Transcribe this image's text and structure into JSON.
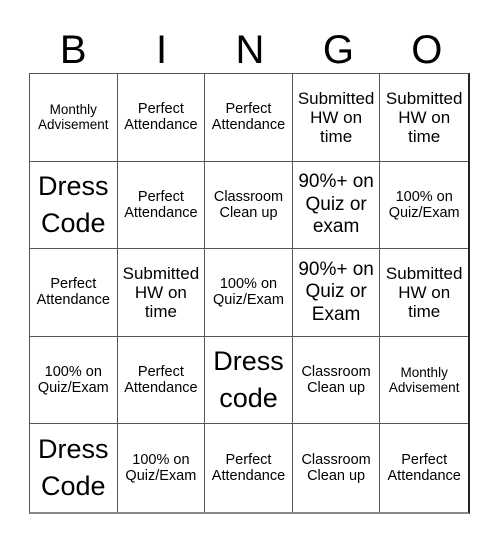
{
  "header": {
    "letters": [
      "B",
      "I",
      "N",
      "G",
      "O"
    ]
  },
  "board": {
    "rows": [
      [
        "Monthly Advisement",
        "Perfect Attendance",
        "Perfect Attendance",
        "Submitted HW on time",
        "Submitted HW on time"
      ],
      [
        "Dress Code",
        "Perfect Attendance",
        "Classroom Clean up",
        "90%+ on Quiz or exam",
        "100% on Quiz/Exam"
      ],
      [
        "Perfect Attendance",
        "Submitted HW on time",
        "100% on Quiz/Exam",
        "90%+ on Quiz or Exam",
        "Submitted HW on time"
      ],
      [
        "100% on Quiz/Exam",
        "Perfect Attendance",
        "Dress code",
        "Classroom Clean up",
        "Monthly Advisement"
      ],
      [
        "Dress Code",
        "100% on Quiz/Exam",
        "Perfect Attendance",
        "Classroom Clean up",
        "Perfect Attendance"
      ]
    ]
  }
}
